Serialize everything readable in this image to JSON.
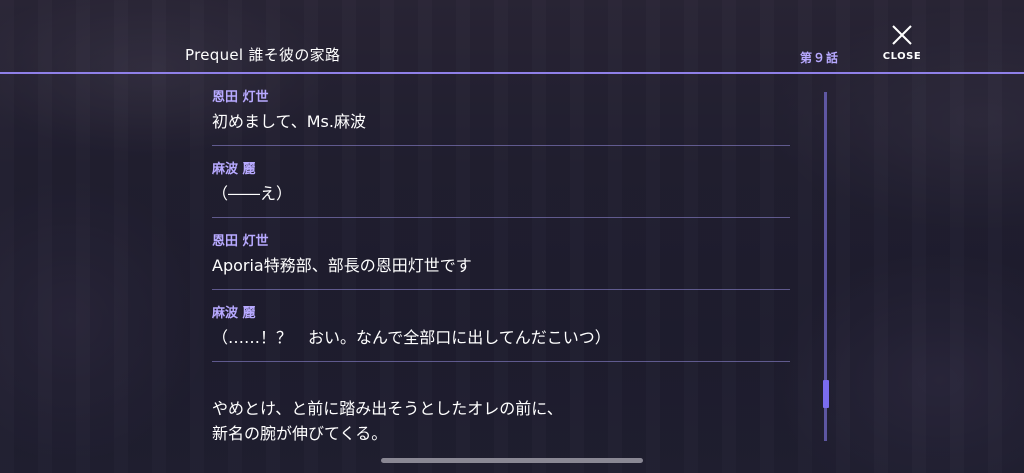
{
  "header": {
    "title": "Prequel 誰そ彼の家路",
    "chapter": "第９話",
    "close_label": "CLOSE"
  },
  "log": [
    {
      "speaker": "恩田 灯世",
      "text": "初めまして、Ms.麻波"
    },
    {
      "speaker": "麻波 麗",
      "text": "（――え）"
    },
    {
      "speaker": "恩田 灯世",
      "text": "Aporia特務部、部長の恩田灯世です"
    },
    {
      "speaker": "麻波 麗",
      "text": "（……！？　おい。なんで全部口に出してんだこいつ）"
    }
  ],
  "narration": {
    "line1": "やめとけ、と前に踏み出そうとしたオレの前に、",
    "line2": "新名の腕が伸びてくる。"
  },
  "icons": {
    "close": "close-icon"
  },
  "colors": {
    "accent": "#8f80e8",
    "speaker": "#b7a9ff",
    "text": "#ffffff"
  }
}
